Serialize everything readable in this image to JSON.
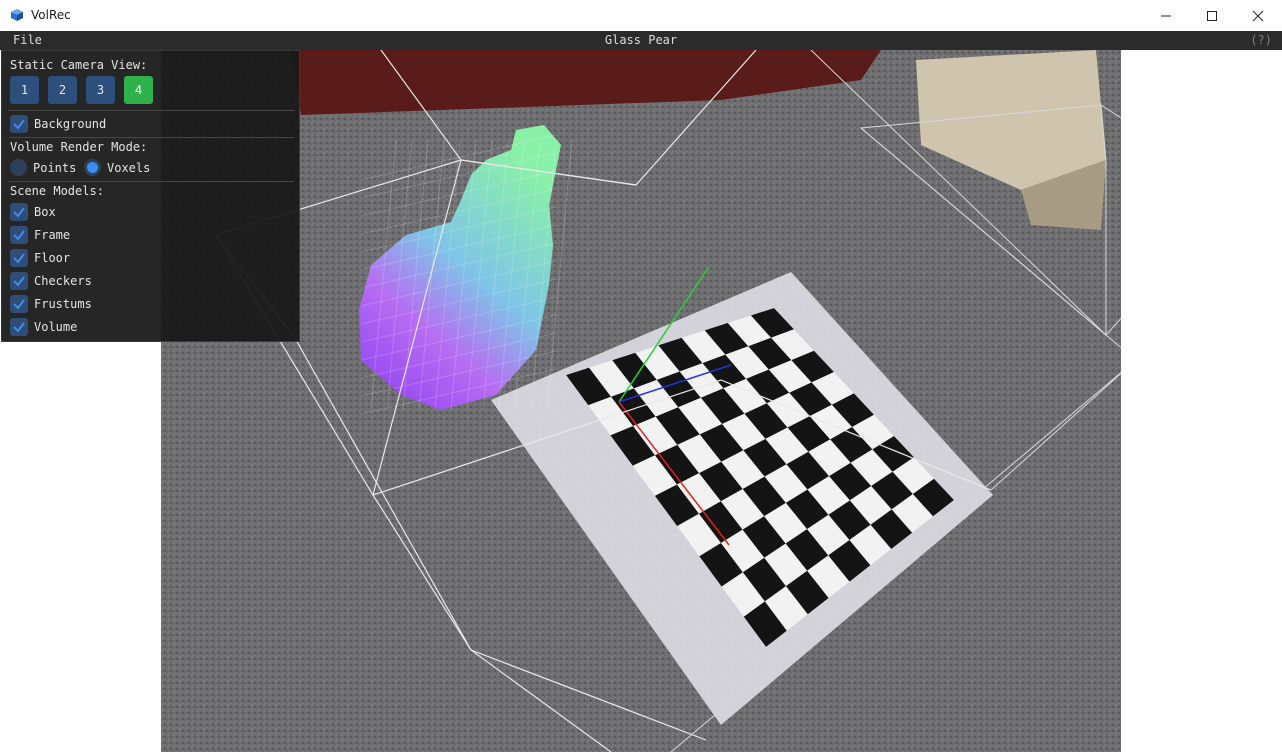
{
  "window": {
    "title": "VolRec",
    "minimize_icon": "minimize-icon",
    "maximize_icon": "maximize-icon",
    "close_icon": "close-icon"
  },
  "menubar": {
    "file_label": "File",
    "scene_title": "Glass Pear",
    "help_label": "(?)"
  },
  "panel": {
    "camera_section_label": "Static Camera View:",
    "camera_buttons": [
      "1",
      "2",
      "3",
      "4"
    ],
    "active_camera": "4",
    "background": {
      "label": "Background",
      "checked": true
    },
    "render_mode_label": "Volume Render Mode:",
    "render_modes": [
      {
        "label": "Points",
        "selected": false
      },
      {
        "label": "Voxels",
        "selected": true
      }
    ],
    "scene_models_label": "Scene Models:",
    "scene_models": [
      {
        "label": "Box",
        "checked": true
      },
      {
        "label": "Frame",
        "checked": true
      },
      {
        "label": "Floor",
        "checked": true
      },
      {
        "label": "Checkers",
        "checked": true
      },
      {
        "label": "Frustums",
        "checked": true
      },
      {
        "label": "Volume",
        "checked": true
      }
    ]
  },
  "colors": {
    "accent": "#3d8cf0",
    "active_button": "#2fb14c",
    "button": "#2d4f7c",
    "panel_bg": "#181818",
    "menubar_bg": "#2b2b2b"
  }
}
